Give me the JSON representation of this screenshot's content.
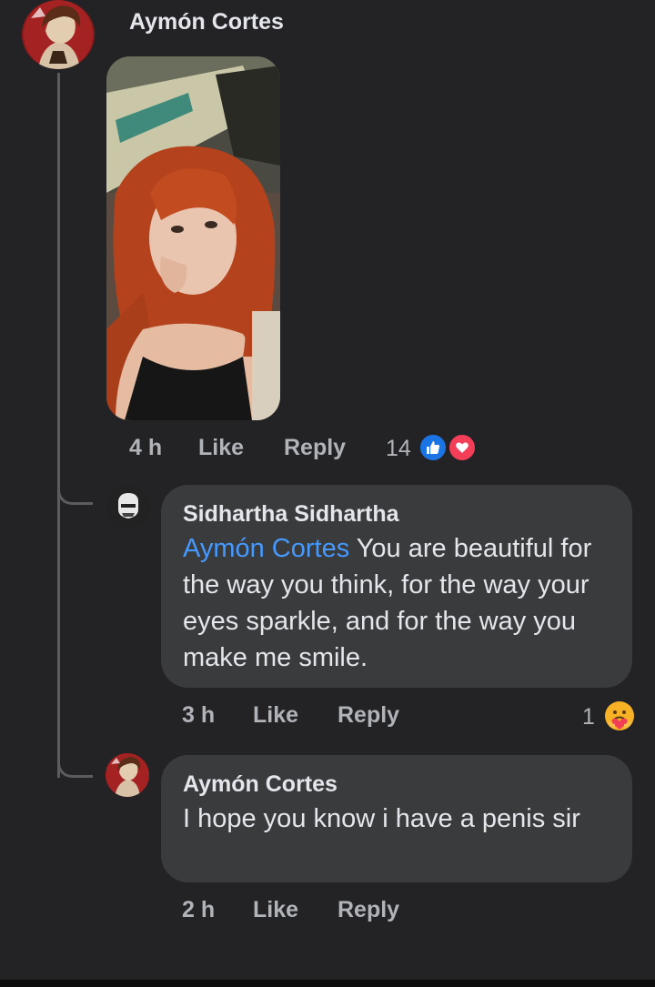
{
  "post": {
    "author": "Aymón Cortes",
    "time": "4 h",
    "like_label": "Like",
    "reply_label": "Reply",
    "reaction_count": "14",
    "reaction_icons": [
      "like-icon",
      "love-icon"
    ]
  },
  "replies": [
    {
      "author": "Sidhartha Sidhartha",
      "mention": "Aymón Cortes",
      "text": " You are beautiful for the way you think, for the way your eyes sparkle, and for the way you make me smile.",
      "time": "3 h",
      "like_label": "Like",
      "reply_label": "Reply",
      "reaction_count": "1",
      "reaction_icon": "care-icon"
    },
    {
      "author": "Aymón Cortes",
      "text": "I hope you know i have a penis sir",
      "time": "2 h",
      "like_label": "Like",
      "reply_label": "Reply"
    }
  ],
  "colors": {
    "background": "#232326",
    "bubble": "#3a3b3c",
    "mention": "#4599ff",
    "like": "#1b74e4",
    "love": "#f33e58"
  }
}
